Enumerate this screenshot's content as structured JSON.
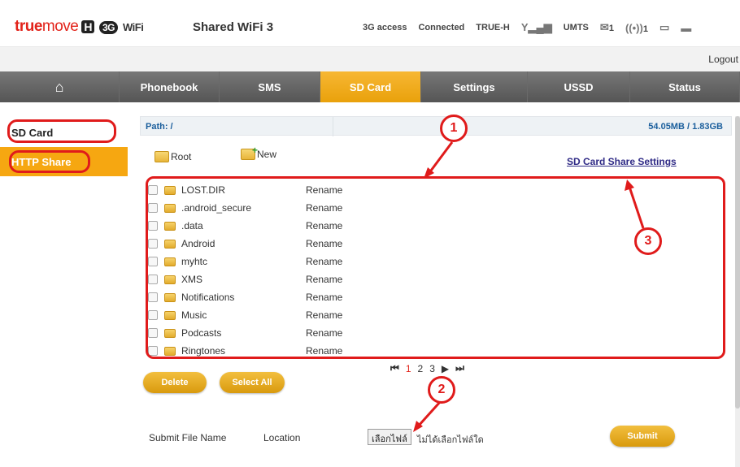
{
  "header": {
    "brand_true": "true",
    "brand_move": "move",
    "brand_h": "H",
    "brand_3g": "3G",
    "brand_wifi_w": "WiFi",
    "title": "Shared WiFi 3",
    "status": {
      "access": "3G access",
      "connection": "Connected",
      "operator": "TRUE-H",
      "network": "UMTS",
      "sms_count": "1",
      "signal_sub": "1"
    },
    "logout": "Logout"
  },
  "nav": {
    "home_icon": "home-icon",
    "items": [
      "Phonebook",
      "SMS",
      "SD Card",
      "Settings",
      "USSD",
      "Status"
    ],
    "active": "SD Card"
  },
  "sidebar": {
    "items": [
      "SD Card",
      "HTTP Share"
    ]
  },
  "main": {
    "path_label": "Path: /",
    "capacity": "54.05MB / 1.83GB",
    "root_label": "Root",
    "new_label": "New",
    "share_settings": "SD Card Share Settings",
    "rename_label": "Rename",
    "files": [
      "LOST.DIR",
      ".android_secure",
      ".data",
      "Android",
      "myhtc",
      "XMS",
      "Notifications",
      "Music",
      "Podcasts",
      "Ringtones"
    ],
    "pager": {
      "first": "first-page-icon",
      "pages": [
        "1",
        "2",
        "3"
      ],
      "current": "1",
      "next": "next-page-icon",
      "last": "last-page-icon"
    },
    "delete_label": "Delete",
    "select_all_label": "Select All",
    "submit_file_name": "Submit File Name",
    "location": "Location",
    "choose_file": "เลือกไฟล์",
    "no_file": "ไม่ได้เลือกไฟล์ใด",
    "submit_label": "Submit"
  },
  "annotations": {
    "badges": [
      "1",
      "2",
      "3"
    ],
    "color": "#e01b1b"
  },
  "colors": {
    "accent": "#f6a711",
    "brand_red": "#e2231a",
    "nav_gray": "#666666",
    "link": "#2f2a86"
  }
}
